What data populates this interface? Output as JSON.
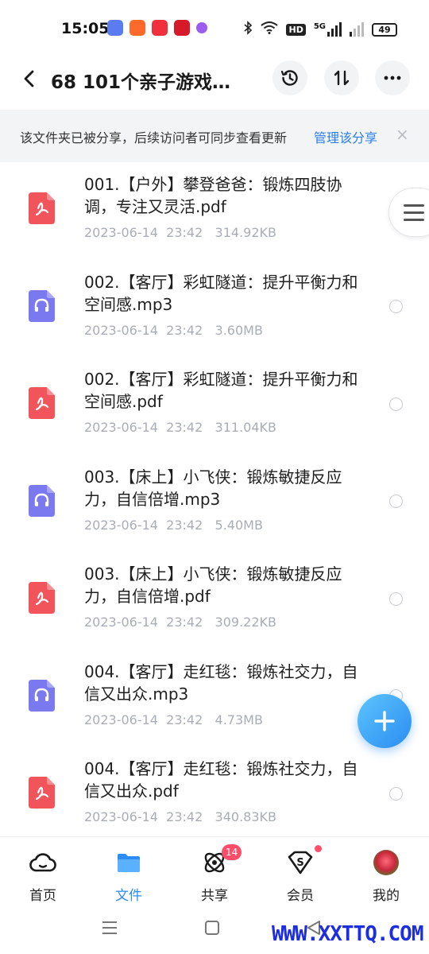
{
  "status_bar": {
    "time": "15:05",
    "signal": "5G",
    "hd": "HD",
    "battery": "49"
  },
  "header": {
    "title": "68 101个亲子游戏…"
  },
  "banner": {
    "text": "该文件夹已被分享，后续访问者可同步查看更新",
    "link": "管理该分享",
    "close": "×"
  },
  "files": [
    {
      "type": "pdf",
      "name": "001.【户外】攀登爸爸：锻炼四肢协调，专注又灵活.pdf",
      "meta": "2023-06-14  23:42   314.92KB"
    },
    {
      "type": "mp3",
      "name": "002.【客厅】彩虹隧道：提升平衡力和空间感.mp3",
      "meta": "2023-06-14  23:42   3.60MB"
    },
    {
      "type": "pdf",
      "name": "002.【客厅】彩虹隧道：提升平衡力和空间感.pdf",
      "meta": "2023-06-14  23:42   311.04KB"
    },
    {
      "type": "mp3",
      "name": "003.【床上】小飞侠：锻炼敏捷反应力，自信倍增.mp3",
      "meta": "2023-06-14  23:42   5.40MB"
    },
    {
      "type": "pdf",
      "name": "003.【床上】小飞侠：锻炼敏捷反应力，自信倍增.pdf",
      "meta": "2023-06-14  23:42   309.22KB"
    },
    {
      "type": "mp3",
      "name": "004.【客厅】走红毯：锻炼社交力，自信又出众.mp3",
      "meta": "2023-06-14  23:42   4.73MB"
    },
    {
      "type": "pdf",
      "name": "004.【客厅】走红毯：锻炼社交力，自信又出众.pdf",
      "meta": "2023-06-14  23:42   340.83KB"
    }
  ],
  "nav": {
    "home": "首页",
    "files": "文件",
    "share": "共享",
    "share_badge": "14",
    "vip": "会员",
    "mine": "我的"
  },
  "watermark": "WWW.XXTTQ.COM",
  "colors": {
    "accent": "#2b8cf4",
    "pdf": "#f2545b",
    "audio": "#7b79f0",
    "badge": "#ff4d6a"
  }
}
